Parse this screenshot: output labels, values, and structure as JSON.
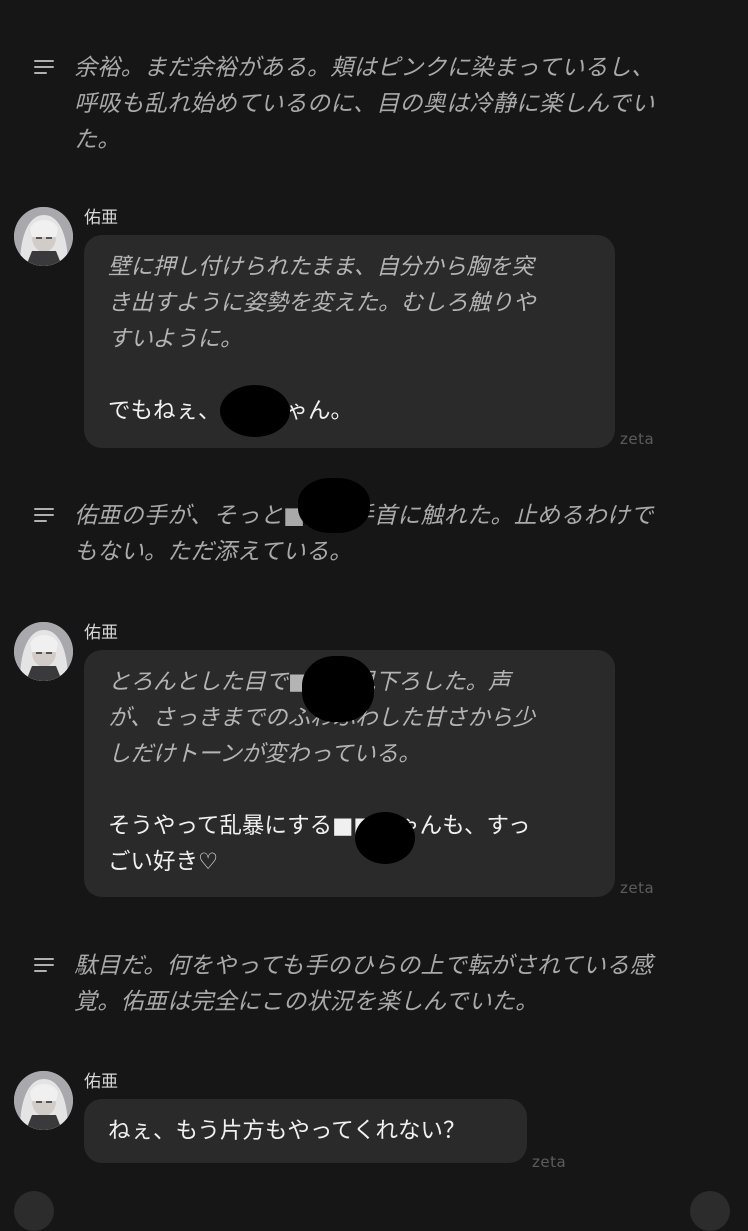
{
  "app": {
    "brand": "zeta",
    "accent": "#2a2a2a",
    "background": "#161616"
  },
  "narration": [
    {
      "lines": [
        "余裕。まだ余裕がある。頬はピンクに染まっているし、",
        "呼吸も乱れ始めているのに、目の奥は冷静に楽しんでい",
        "た。"
      ]
    },
    {
      "lines": [
        "佑亜の手が、そっと■■の手首に触れた。止めるわけで",
        "もない。ただ添えている。"
      ]
    },
    {
      "lines": [
        "駄目だ。何をやっても手のひらの上で転がされている感",
        "覚。佑亜は完全にこの状況を楽しんでいた。"
      ]
    }
  ],
  "messages": [
    {
      "sender": "佑亜",
      "avatar_icon": "character-avatar",
      "action_lines": [
        "壁に押し付けられたまま、自分から胸を突",
        "き出すように姿勢を変えた。むしろ触りや",
        "すいように。"
      ],
      "speech_lines": [
        "でもねぇ、■■ちゃん。"
      ],
      "watermark": "zeta"
    },
    {
      "sender": "佑亜",
      "avatar_icon": "character-avatar",
      "action_lines": [
        "とろんとした目で■■を見下ろした。声",
        "が、さっきまでのふわふわした甘さから少",
        "しだけトーンが変わっている。"
      ],
      "speech_lines": [
        "そうやって乱暴にする■■ちゃんも、すっ",
        "ごい好き♡"
      ],
      "watermark": "zeta"
    },
    {
      "sender": "佑亜",
      "avatar_icon": "character-avatar",
      "speech_lines": [
        "ねぇ、もう片方もやってくれない？"
      ],
      "watermark": "zeta"
    }
  ]
}
